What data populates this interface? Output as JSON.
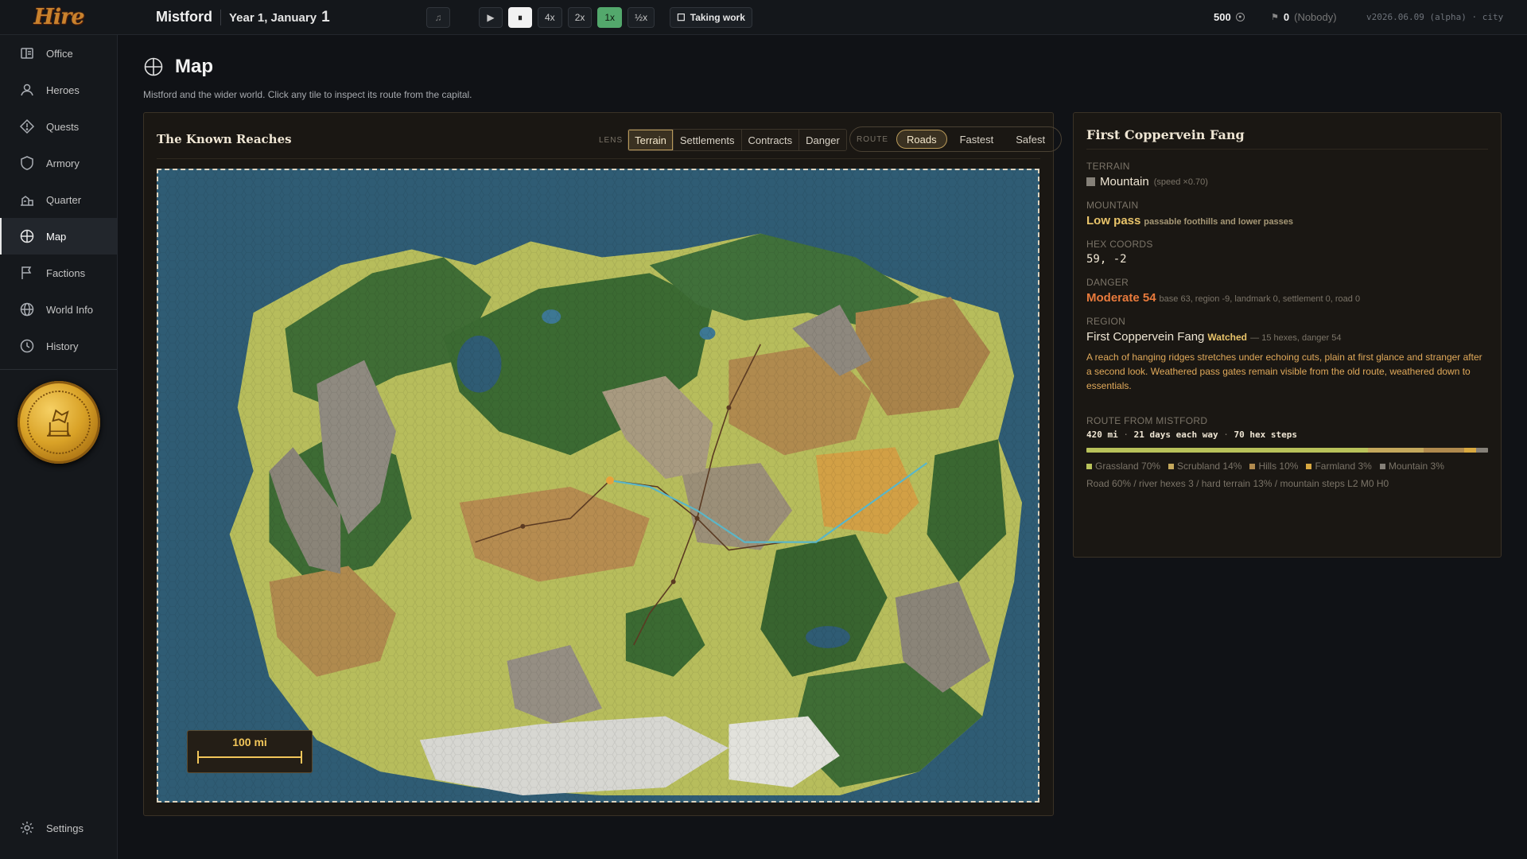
{
  "app": {
    "logo": "Hire",
    "city": "Mistford",
    "date": "Year 1, January",
    "day": "1"
  },
  "topbar": {
    "speeds": [
      "▶",
      "⏸",
      "4x",
      "2x",
      "1x",
      "½x"
    ],
    "taking_work": "Taking work",
    "gold": "500",
    "guild_count": "0",
    "guild_name": "(Nobody)",
    "version": "v2026.06.09 (alpha) · city"
  },
  "sidebar": {
    "items": [
      {
        "label": "Office",
        "icon": "office-icon"
      },
      {
        "label": "Heroes",
        "icon": "person-icon"
      },
      {
        "label": "Quests",
        "icon": "diamond-icon"
      },
      {
        "label": "Armory",
        "icon": "shield-icon"
      },
      {
        "label": "Quarter",
        "icon": "buildings-icon"
      },
      {
        "label": "Map",
        "icon": "compass-icon"
      },
      {
        "label": "Factions",
        "icon": "flag-icon"
      },
      {
        "label": "World Info",
        "icon": "globe-icon"
      },
      {
        "label": "History",
        "icon": "clock-icon"
      }
    ],
    "settings": "Settings"
  },
  "page": {
    "title": "Map",
    "subtitle": "Mistford and the wider world. Click any tile to inspect its route from the capital."
  },
  "map": {
    "title": "The Known Reaches",
    "lens_label": "LENS",
    "lens": [
      "Terrain",
      "Settlements",
      "Contracts",
      "Danger"
    ],
    "route_label": "ROUTE",
    "route": [
      "Roads",
      "Fastest",
      "Safest"
    ],
    "scale": "100 mi"
  },
  "info": {
    "title": "First Coppervein Fang",
    "terrain_label": "TERRAIN",
    "terrain": "Mountain",
    "terrain_speed": "(speed ×0.70)",
    "mountain_label": "MOUNTAIN",
    "mountain": "Low pass",
    "mountain_note": "passable foothills and lower passes",
    "coords_label": "HEX COORDS",
    "coords": "59, -2",
    "danger_label": "DANGER",
    "danger": "Moderate 54",
    "danger_note": "base 63, region -9, landmark 0, settlement 0, road 0",
    "region_label": "REGION",
    "region": "First Coppervein Fang",
    "region_status": "Watched",
    "region_note": "— 15 hexes, danger 54",
    "region_desc": "A reach of hanging ridges stretches under echoing cuts, plain at first glance and stranger after a second look. Weathered pass gates remain visible from the old route, weathered down to essentials.",
    "route_label": "ROUTE FROM MISTFORD",
    "route_dist": "420 mi",
    "route_days": "21 days each way",
    "route_steps": "70 hex steps",
    "mix": [
      {
        "name": "Grassland 70%",
        "pct": 70,
        "color": "#b9c25a"
      },
      {
        "name": "Scrubland 14%",
        "pct": 14,
        "color": "#c4a85c"
      },
      {
        "name": "Hills 10%",
        "pct": 10,
        "color": "#b08a4e"
      },
      {
        "name": "Farmland 3%",
        "pct": 3,
        "color": "#d8a840"
      },
      {
        "name": "Mountain 3%",
        "pct": 3,
        "color": "#858078"
      }
    ],
    "route_foot": "Road 60%  /  river hexes 3  /  hard terrain 13%  /  mountain steps L2 M0 H0"
  }
}
